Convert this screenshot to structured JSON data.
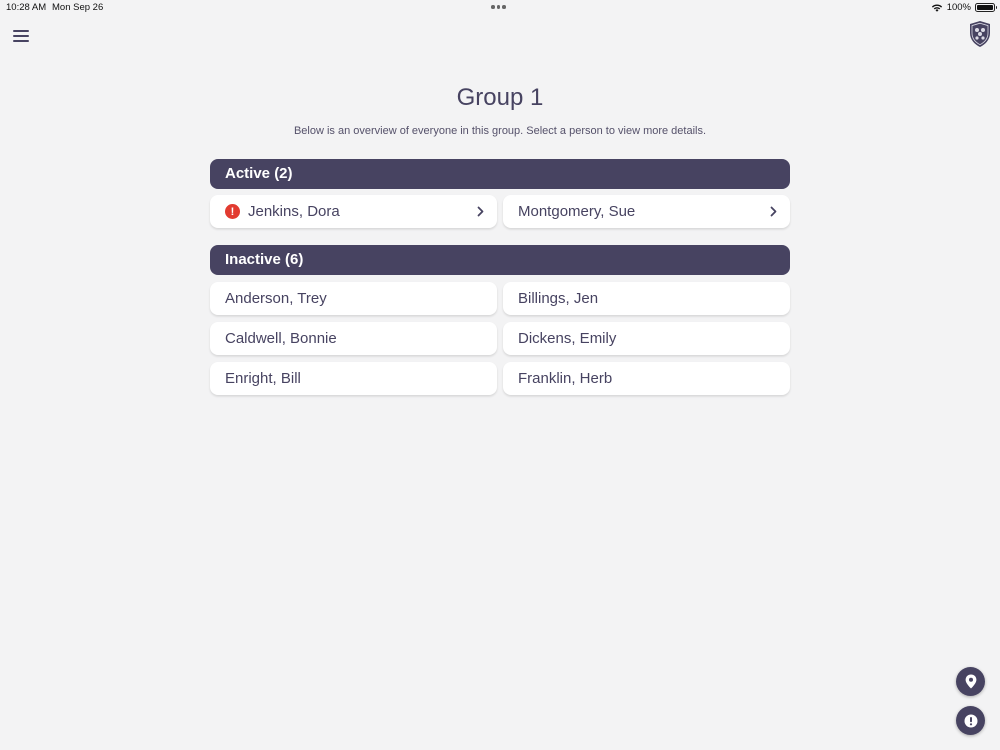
{
  "status_bar": {
    "time": "10:28 AM",
    "date": "Mon Sep 26",
    "battery": "100%"
  },
  "header": {
    "title": "Group 1",
    "subtitle": "Below is an overview of everyone in this group. Select a person to view more details."
  },
  "sections": {
    "active": {
      "label": "Active (2)",
      "people": [
        {
          "name": "Jenkins, Dora",
          "alert": true
        },
        {
          "name": "Montgomery, Sue",
          "alert": false
        }
      ]
    },
    "inactive": {
      "label": "Inactive (6)",
      "people": [
        {
          "name": "Anderson, Trey"
        },
        {
          "name": "Billings, Jen"
        },
        {
          "name": "Caldwell, Bonnie"
        },
        {
          "name": "Dickens, Emily"
        },
        {
          "name": "Enright, Bill"
        },
        {
          "name": "Franklin, Herb"
        }
      ]
    }
  },
  "icons": {
    "menu": "hamburger-menu-icon",
    "logo": "crest-logo",
    "alert": "exclamation-alert-icon",
    "chevron": "chevron-right-icon",
    "location": "location-pin-icon",
    "report": "exclamation-icon",
    "wifi": "wifi-icon",
    "battery": "battery-icon"
  },
  "colors": {
    "primary": "#474361",
    "background": "#f3f3f4",
    "card": "#ffffff",
    "alert": "#e23b30"
  }
}
